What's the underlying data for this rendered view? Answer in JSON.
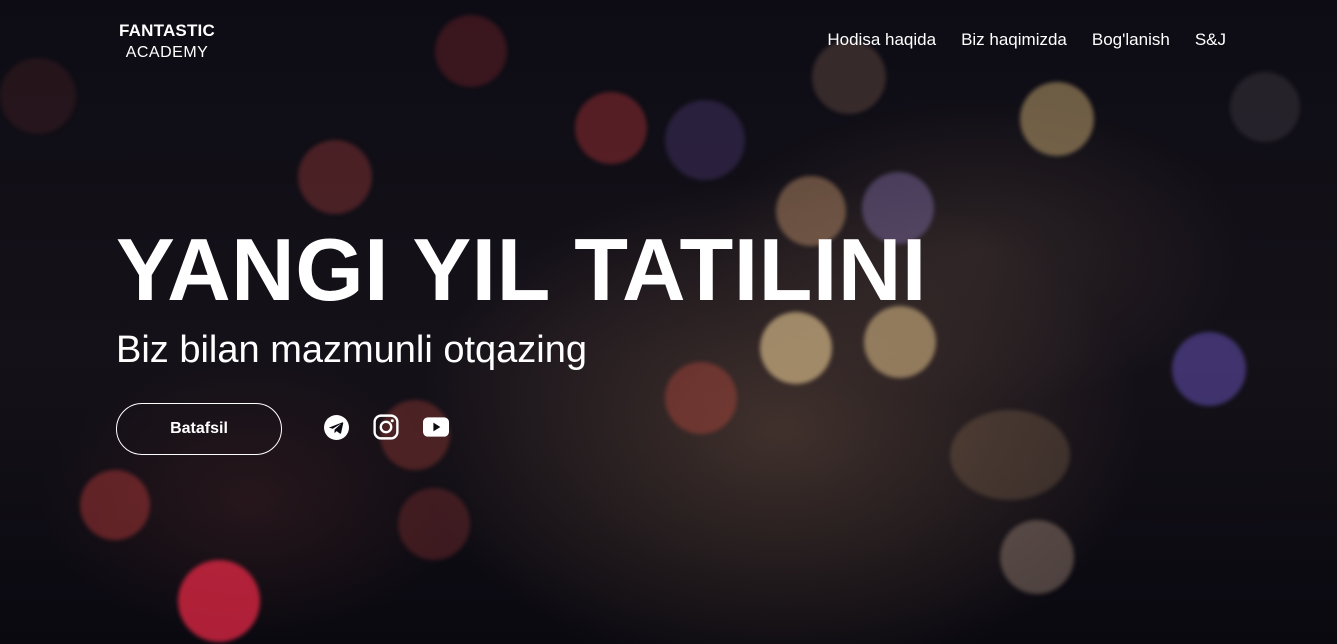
{
  "header": {
    "logo_line1": "FANTASTIC",
    "logo_line2": "ACADEMY",
    "nav": [
      {
        "label": "Hodisa haqida"
      },
      {
        "label": "Biz haqimizda"
      },
      {
        "label": "Bog'lanish"
      },
      {
        "label": "S&J"
      }
    ]
  },
  "hero": {
    "title": "YANGI YIL TATILINI",
    "subtitle": "Biz bilan mazmunli otqazing",
    "cta_label": "Batafsil"
  },
  "socials": [
    {
      "icon": "telegram-icon"
    },
    {
      "icon": "instagram-icon"
    },
    {
      "icon": "youtube-icon"
    }
  ],
  "colors": {
    "background": "#0b0a12",
    "text": "#ffffff"
  }
}
